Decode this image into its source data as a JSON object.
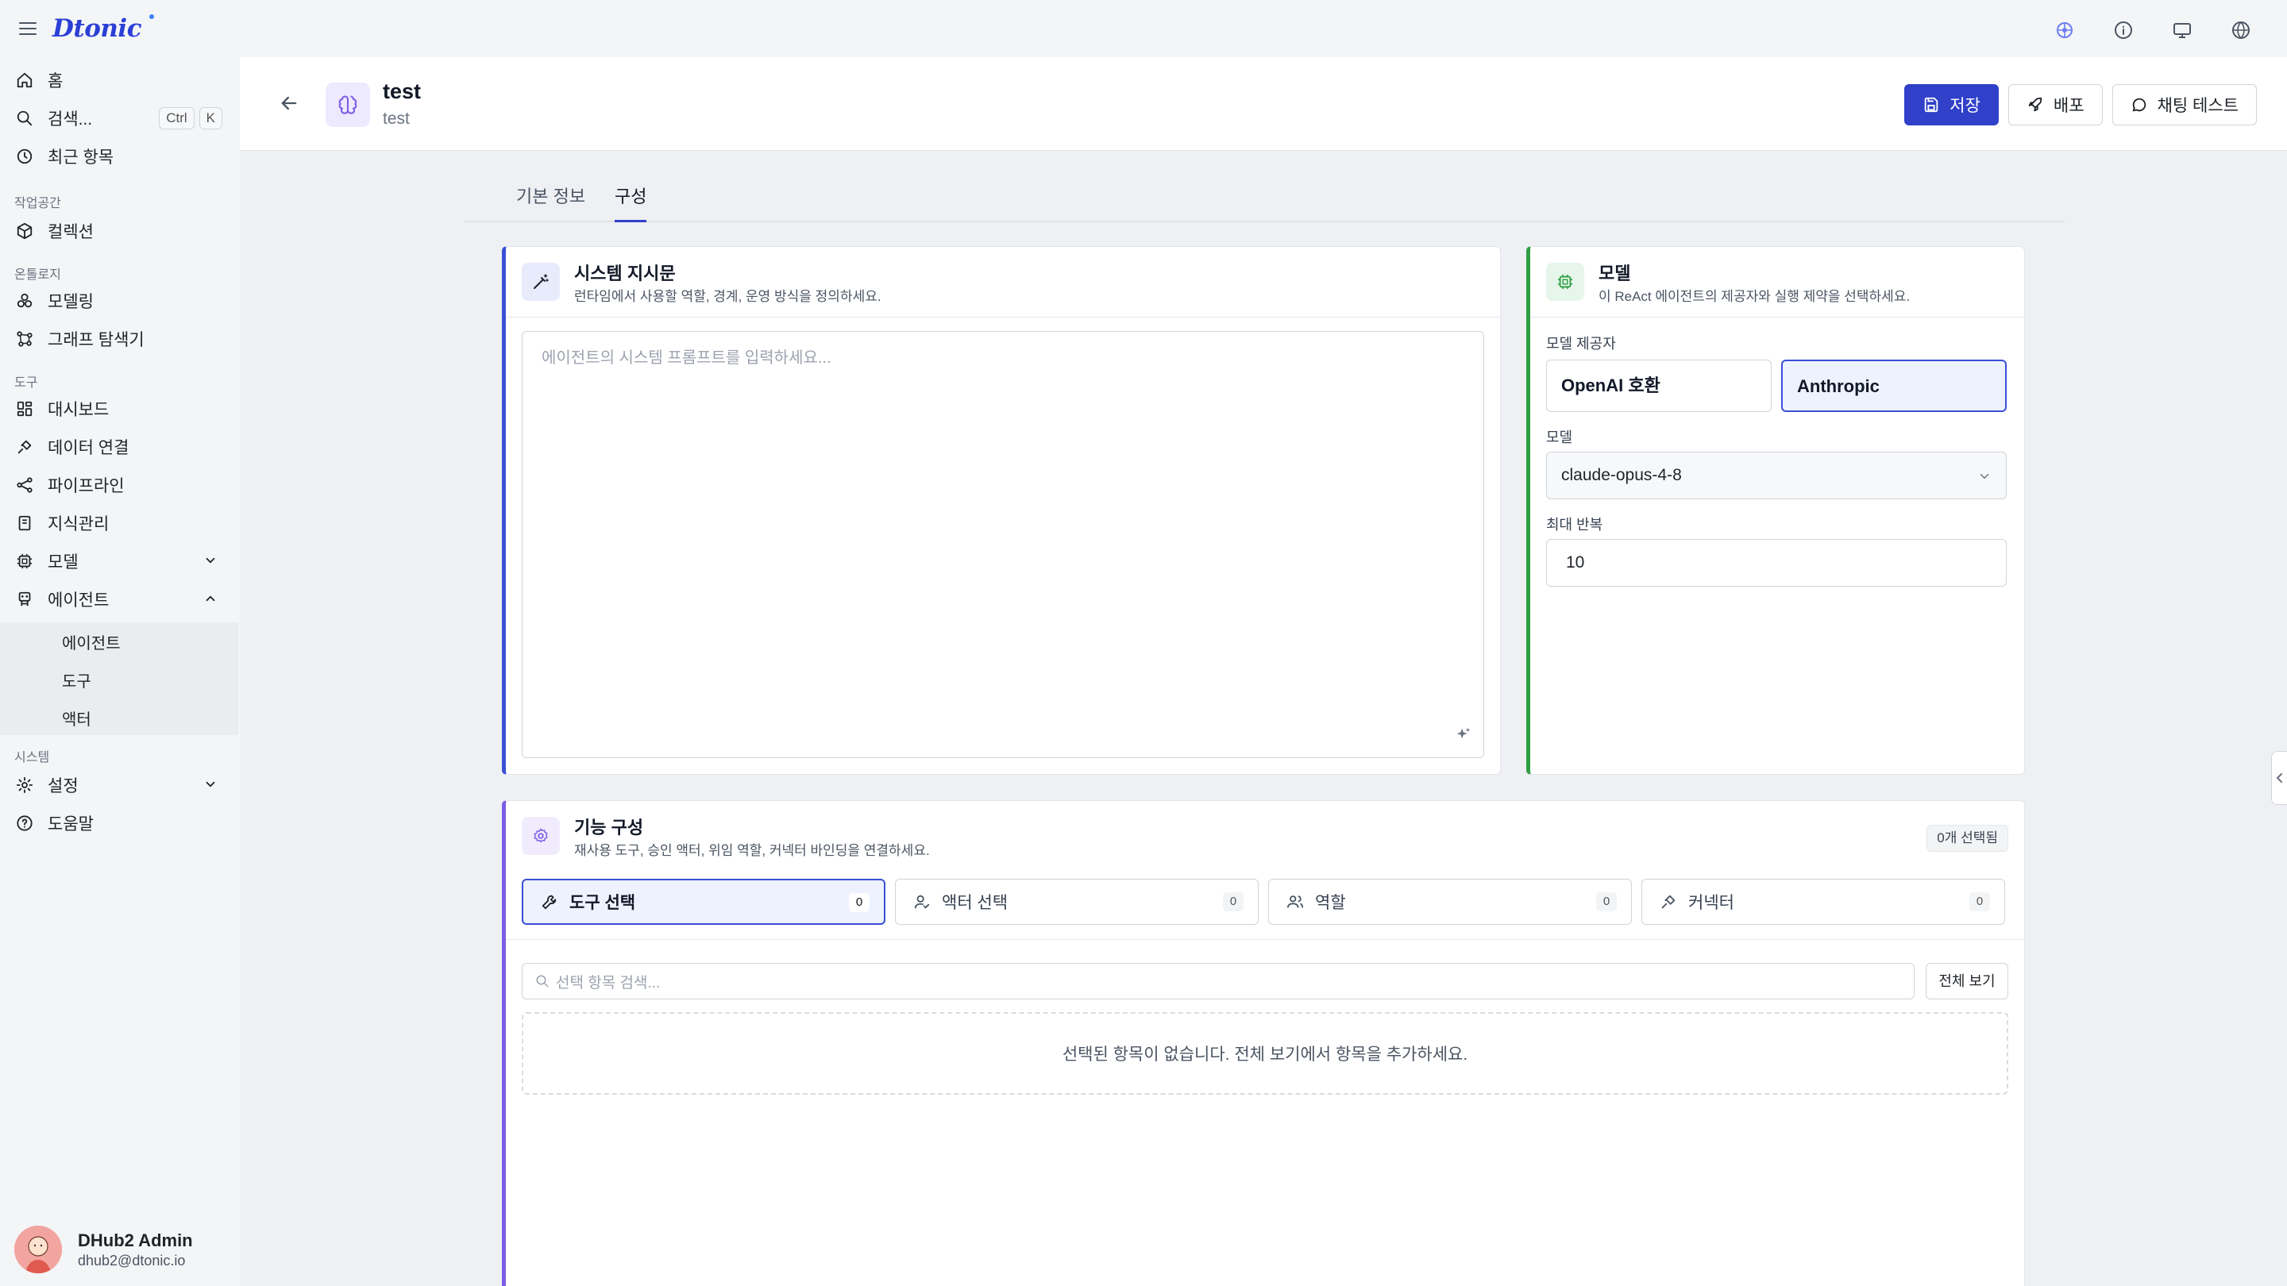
{
  "app": {
    "logo_text": "Dtonic"
  },
  "sidebar": {
    "home": "홈",
    "search": "검색...",
    "kbd": [
      "Ctrl",
      "K"
    ],
    "recent": "최근 항목",
    "workspace_label": "작업공간",
    "collections": "컬렉션",
    "ontology_label": "온톨로지",
    "modeling": "모델링",
    "graph_explorer": "그래프 탐색기",
    "tools_label": "도구",
    "dashboard": "대시보드",
    "data_connection": "데이터 연결",
    "pipeline": "파이프라인",
    "knowledge": "지식관리",
    "model": "모델",
    "agent": "에이전트",
    "agent_sub": [
      "에이전트",
      "도구",
      "액터"
    ],
    "system_label": "시스템",
    "settings": "설정",
    "help": "도움말",
    "user": {
      "name": "DHub2 Admin",
      "email": "dhub2@dtonic.io"
    }
  },
  "header": {
    "title": "test",
    "subtitle": "test",
    "save": "저장",
    "deploy": "배포",
    "chat_test": "채팅 테스트"
  },
  "tabs": [
    "기본 정보",
    "구성"
  ],
  "system_prompt": {
    "title": "시스템 지시문",
    "desc": "런타임에서 사용할 역할, 경계, 운영 방식을 정의하세요.",
    "placeholder": "에이전트의 시스템 프롬프트를 입력하세요..."
  },
  "model_card": {
    "title": "모델",
    "desc": "이 ReAct 에이전트의 제공자와 실행 제약을 선택하세요.",
    "provider_label": "모델 제공자",
    "providers": [
      "OpenAI 호환",
      "Anthropic"
    ],
    "selected_provider": "Anthropic",
    "model_label": "모델",
    "model_value": "claude-opus-4-8",
    "max_iter_label": "최대 반복",
    "max_iter_value": "10"
  },
  "capabilities": {
    "title": "기능 구성",
    "desc": "재사용 도구, 승인 액터, 위임 역할, 커넥터 바인딩을 연결하세요.",
    "selected_count": "0개 선택됨",
    "segments": [
      {
        "label": "도구 선택",
        "count": "0"
      },
      {
        "label": "액터 선택",
        "count": "0"
      },
      {
        "label": "역할",
        "count": "0"
      },
      {
        "label": "커넥터",
        "count": "0"
      }
    ],
    "search_placeholder": "선택 항목 검색...",
    "view_all": "전체 보기",
    "empty_text": "선택된 항목이 없습니다. 전체 보기에서 항목을 추가하세요."
  },
  "colors": {
    "primary": "#3040c8",
    "accent_blue": "#3b4fd6",
    "accent_green": "#2f9e44",
    "accent_purple": "#7c5ce6"
  }
}
